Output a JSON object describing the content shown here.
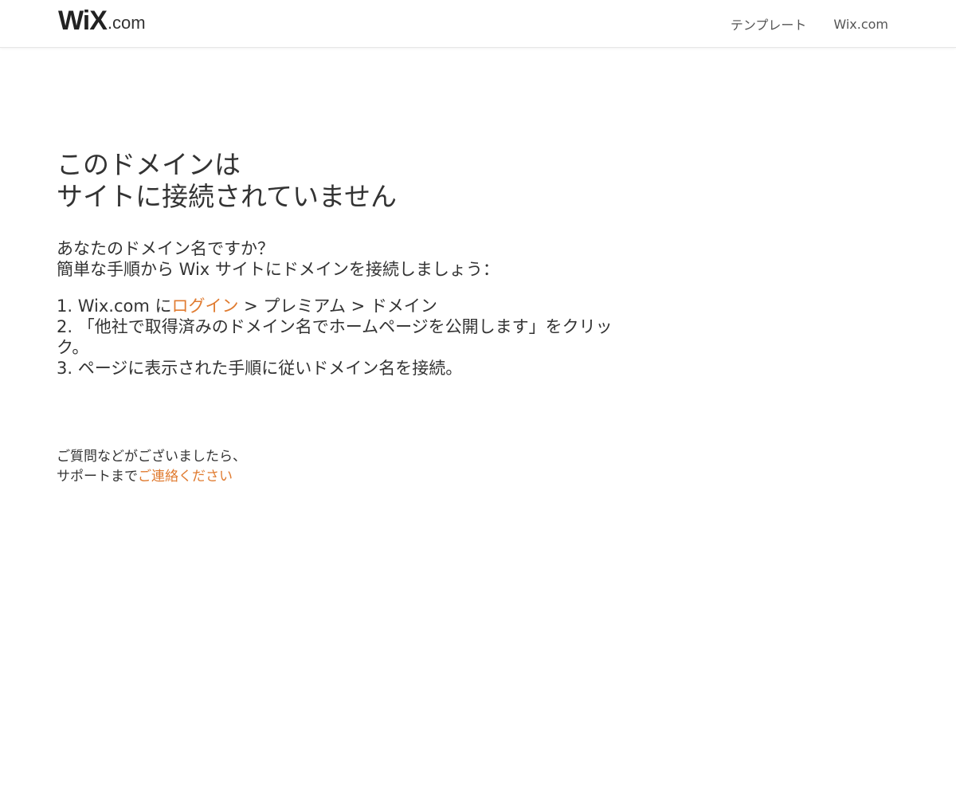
{
  "header": {
    "logo": {
      "wix": "WiX",
      "dotcom": ".com"
    },
    "nav": [
      {
        "label": "テンプレート"
      },
      {
        "label": "Wix.com"
      }
    ]
  },
  "main": {
    "title_line1": "このドメインは",
    "title_line2": "サイトに接続されていません",
    "intro_line1": "あなたのドメイン名ですか？",
    "intro_line2": "簡単な手順から Wix サイトにドメインを接続しましょう：",
    "step1_prefix": "1. Wix.com に",
    "step1_link": "ログイン",
    "step1_suffix": " > プレミアム > ドメイン",
    "step2": "2. 「他社で取得済みのドメイン名でホームページを公開します」をクリック。",
    "step3": "3. ページに表示された手順に従いドメイン名を接続。"
  },
  "contact": {
    "line1": "ご質問などがございましたら、",
    "line2_prefix": "サポートまで",
    "line2_link": "ご連絡ください"
  },
  "colors": {
    "accent": "#e07b30",
    "text": "#333333",
    "nav_text": "#555555"
  }
}
